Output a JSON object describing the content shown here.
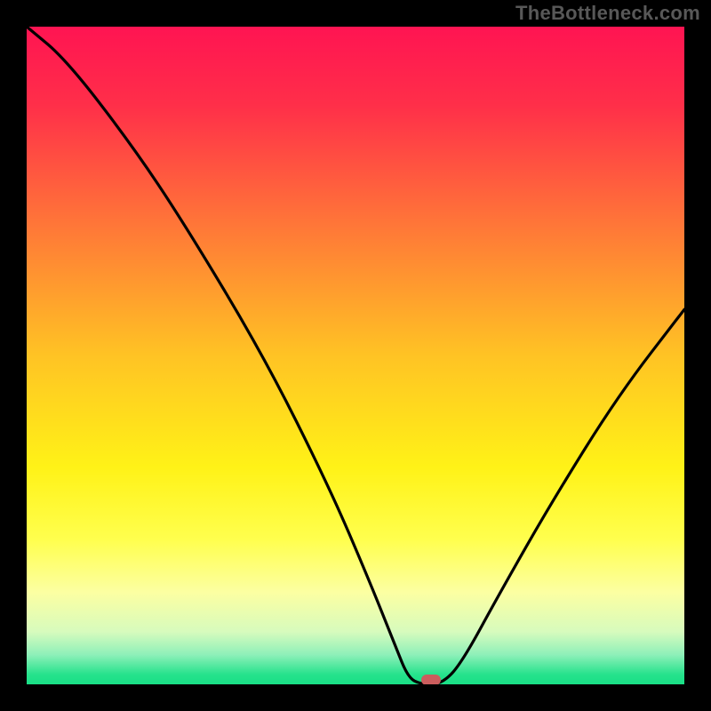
{
  "watermark": "TheBottleneck.com",
  "colors": {
    "frame": "#000000",
    "curve": "#000000",
    "marker": "#cb5d5d",
    "gradient_stops": [
      {
        "offset": 0.0,
        "color": "#ff1452"
      },
      {
        "offset": 0.12,
        "color": "#ff2f49"
      },
      {
        "offset": 0.28,
        "color": "#ff6e3a"
      },
      {
        "offset": 0.5,
        "color": "#ffc324"
      },
      {
        "offset": 0.67,
        "color": "#fff217"
      },
      {
        "offset": 0.78,
        "color": "#ffff4e"
      },
      {
        "offset": 0.86,
        "color": "#fcffa2"
      },
      {
        "offset": 0.92,
        "color": "#d7fbbd"
      },
      {
        "offset": 0.955,
        "color": "#8ef0b9"
      },
      {
        "offset": 0.985,
        "color": "#26e28c"
      },
      {
        "offset": 1.0,
        "color": "#19df86"
      }
    ]
  },
  "chart_data": {
    "type": "line",
    "title": "",
    "xlabel": "",
    "ylabel": "",
    "xlim": [
      0,
      100
    ],
    "ylim": [
      0,
      100
    ],
    "categories_note": "x is relative position 0–100 across plot width; y is relative height 0–100 (0 = bottom / optimal, 100 = top / worst)",
    "series": [
      {
        "name": "bottleneck-curve",
        "points": [
          {
            "x": 0,
            "y": 100
          },
          {
            "x": 6,
            "y": 95
          },
          {
            "x": 16,
            "y": 82
          },
          {
            "x": 24,
            "y": 70
          },
          {
            "x": 36,
            "y": 50
          },
          {
            "x": 46,
            "y": 30
          },
          {
            "x": 52,
            "y": 16
          },
          {
            "x": 56,
            "y": 6
          },
          {
            "x": 58,
            "y": 1
          },
          {
            "x": 60,
            "y": 0
          },
          {
            "x": 63,
            "y": 0
          },
          {
            "x": 66,
            "y": 3
          },
          {
            "x": 72,
            "y": 14
          },
          {
            "x": 80,
            "y": 28
          },
          {
            "x": 90,
            "y": 44
          },
          {
            "x": 100,
            "y": 57
          }
        ]
      }
    ],
    "marker": {
      "x": 61.5,
      "y": 0.7,
      "label": "optimal-point"
    }
  }
}
